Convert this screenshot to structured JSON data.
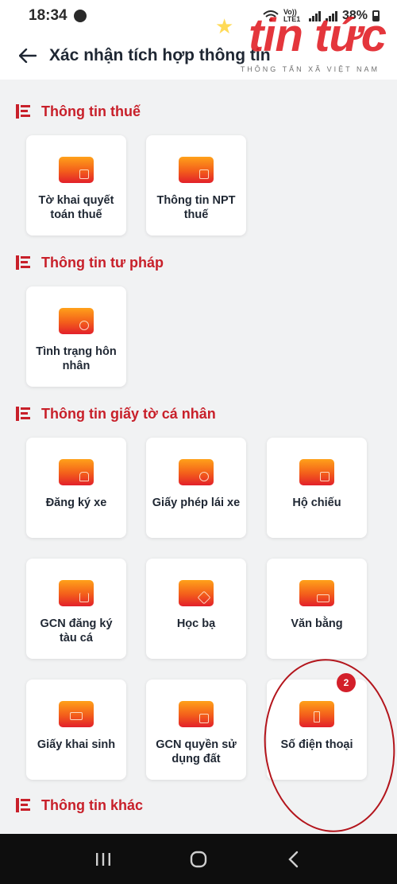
{
  "status_bar": {
    "time": "18:34",
    "network": "Vo)) LTE1",
    "battery": "38%"
  },
  "header": {
    "title": "Xác nhận tích hợp thông tin"
  },
  "watermark": {
    "brand": "tin tức",
    "tagline": "THÔNG TẤN XÃ VIỆT NAM"
  },
  "sections": [
    {
      "title": "Thông tin thuế",
      "items": [
        {
          "label": "Tờ khai quyết toán thuế",
          "icon": "tax-document-icon"
        },
        {
          "label": "Thông tin NPT thuế",
          "icon": "dependents-icon"
        }
      ]
    },
    {
      "title": "Thông tin tư pháp",
      "items": [
        {
          "label": "Tình trạng hôn nhân",
          "icon": "marriage-rings-icon"
        }
      ]
    },
    {
      "title": "Thông tin giấy tờ cá nhân",
      "items": [
        {
          "label": "Đăng ký xe",
          "icon": "car-icon"
        },
        {
          "label": "Giấy phép lái xe",
          "icon": "driver-license-icon"
        },
        {
          "label": "Hộ chiếu",
          "icon": "passport-icon"
        },
        {
          "label": "GCN đăng ký tàu cá",
          "icon": "fishing-boat-icon"
        },
        {
          "label": "Học bạ",
          "icon": "graduation-cap-icon"
        },
        {
          "label": "Văn bằng",
          "icon": "diploma-icon"
        },
        {
          "label": "Giấy khai sinh",
          "icon": "birth-certificate-icon"
        },
        {
          "label": "GCN quyền sử dụng đất",
          "icon": "land-certificate-icon"
        },
        {
          "label": "Số điện thoại",
          "icon": "phone-tower-icon",
          "badge": "2"
        }
      ]
    },
    {
      "title": "Thông tin khác",
      "items": []
    }
  ],
  "colors": {
    "accent": "#c8202a",
    "icon_top": "#ffa11a",
    "icon_bottom": "#e2202a",
    "background": "#f1f2f3"
  }
}
